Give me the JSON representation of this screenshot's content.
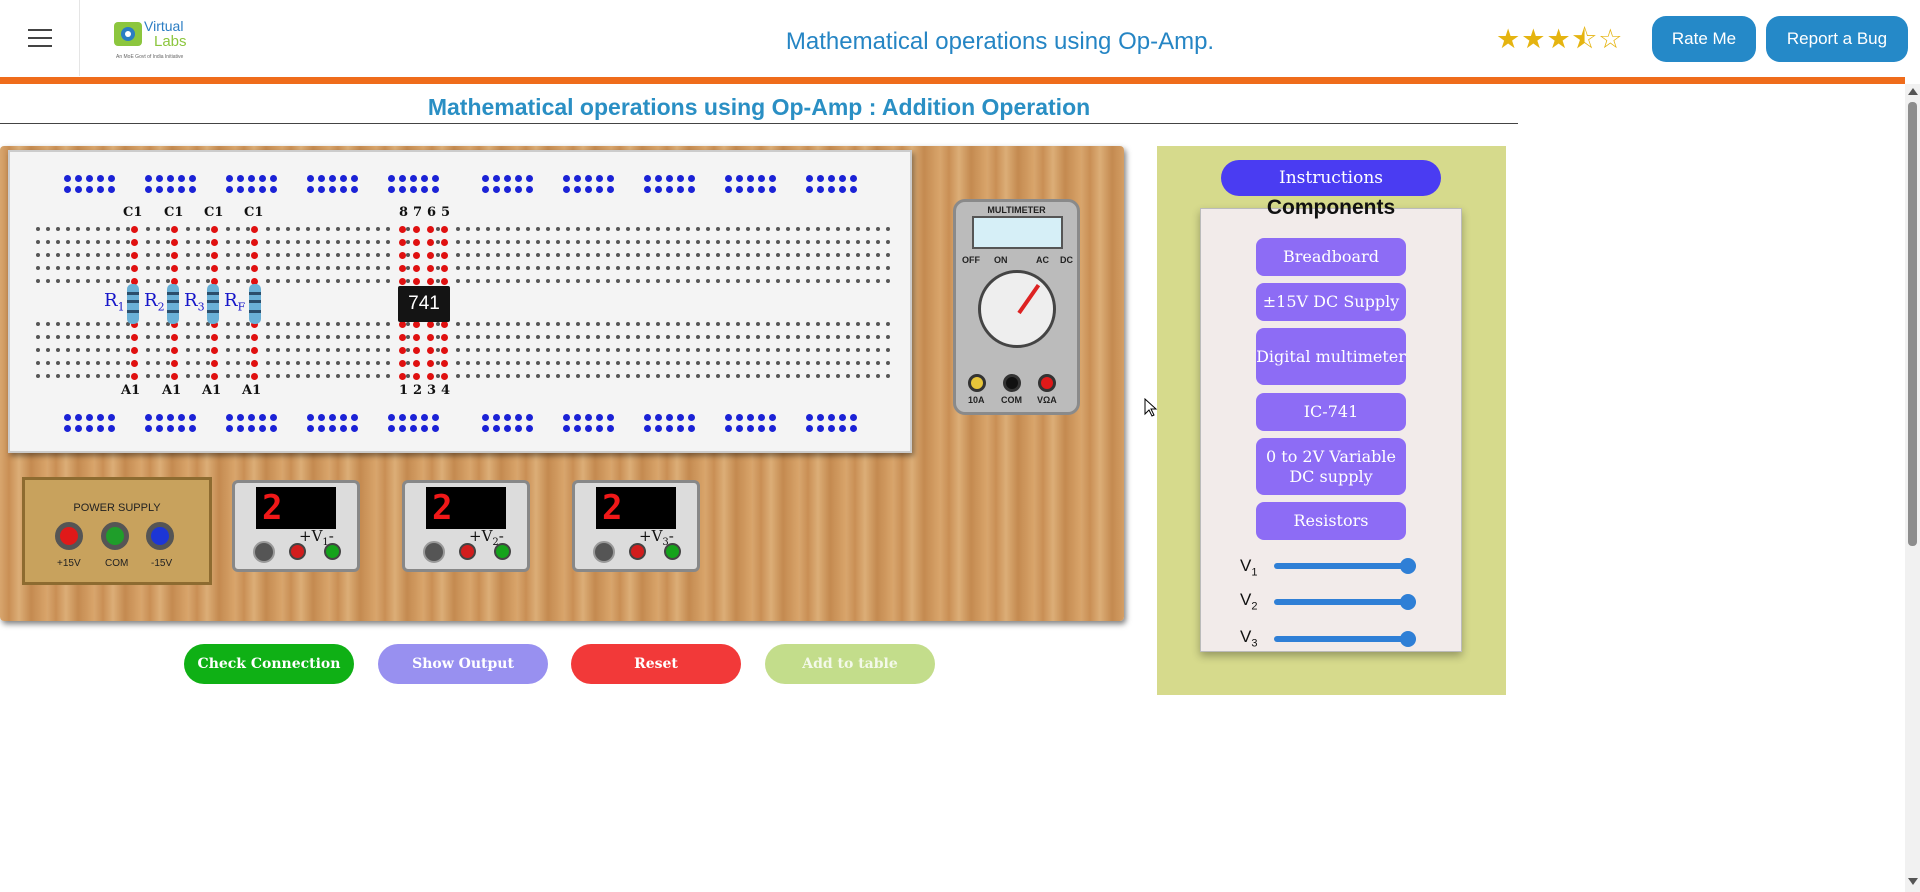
{
  "header": {
    "app_title": "Mathematical operations using Op-Amp.",
    "logo": {
      "line1": "Virtual",
      "line2": "Labs",
      "tagline": "An MoE Govt of India Initiative"
    },
    "rating": {
      "value": 3.5,
      "max": 5
    },
    "rate_button": "Rate Me",
    "bug_button": "Report a Bug"
  },
  "experiment_title": "Mathematical operations using Op-Amp : Addition Operation",
  "breadboard": {
    "top_labels": [
      "C1",
      "C1",
      "C1",
      "C1"
    ],
    "bottom_labels": [
      "A1",
      "A1",
      "A1",
      "A1"
    ],
    "resistor_labels": [
      {
        "base": "R",
        "sub": "1"
      },
      {
        "base": "R",
        "sub": "2"
      },
      {
        "base": "R",
        "sub": "3"
      },
      {
        "base": "R",
        "sub": "F"
      }
    ],
    "ic_label": "741",
    "ic_top_pins": [
      "8",
      "7",
      "6",
      "5"
    ],
    "ic_bottom_pins": [
      "1",
      "2",
      "3",
      "4"
    ]
  },
  "multimeter": {
    "title": "MULTIMETER",
    "off": "OFF",
    "on": "ON",
    "ac": "AC",
    "dc": "DC",
    "jack_labels": [
      "10A",
      "COM",
      "VΩA"
    ]
  },
  "power_supply": {
    "title": "POWER SUPPLY",
    "terminals": [
      "+15V",
      "COM",
      "-15V"
    ]
  },
  "voltmeters": [
    {
      "display": "2",
      "label": "+V",
      "sub": "1",
      "tag": "-"
    },
    {
      "display": "2",
      "label": "+V",
      "sub": "2",
      "tag": "-"
    },
    {
      "display": "2",
      "label": "+V",
      "sub": "3",
      "tag": "-"
    }
  ],
  "actions": {
    "check": "Check Connection",
    "output": "Show Output",
    "reset": "Reset",
    "add": "Add to table"
  },
  "side_panel": {
    "instructions": "Instructions",
    "components_title": "Components",
    "components": [
      "Breadboard",
      "±15V DC Supply",
      "Digital multimeter",
      "IC-741",
      "0 to 2V Variable DC supply",
      "Resistors"
    ],
    "sliders": [
      {
        "label": "V",
        "sub": "1",
        "value": 1.0
      },
      {
        "label": "V",
        "sub": "2",
        "value": 1.0
      },
      {
        "label": "V",
        "sub": "3",
        "value": 1.0
      }
    ]
  },
  "colors": {
    "accent_orange": "#ef6c1b",
    "title_blue": "#2585c4",
    "button_blue": "#2589c8",
    "check_green": "#0fb015",
    "output_purple": "#9890f0",
    "reset_red": "#f23939",
    "add_green": "#c3dd8b"
  }
}
